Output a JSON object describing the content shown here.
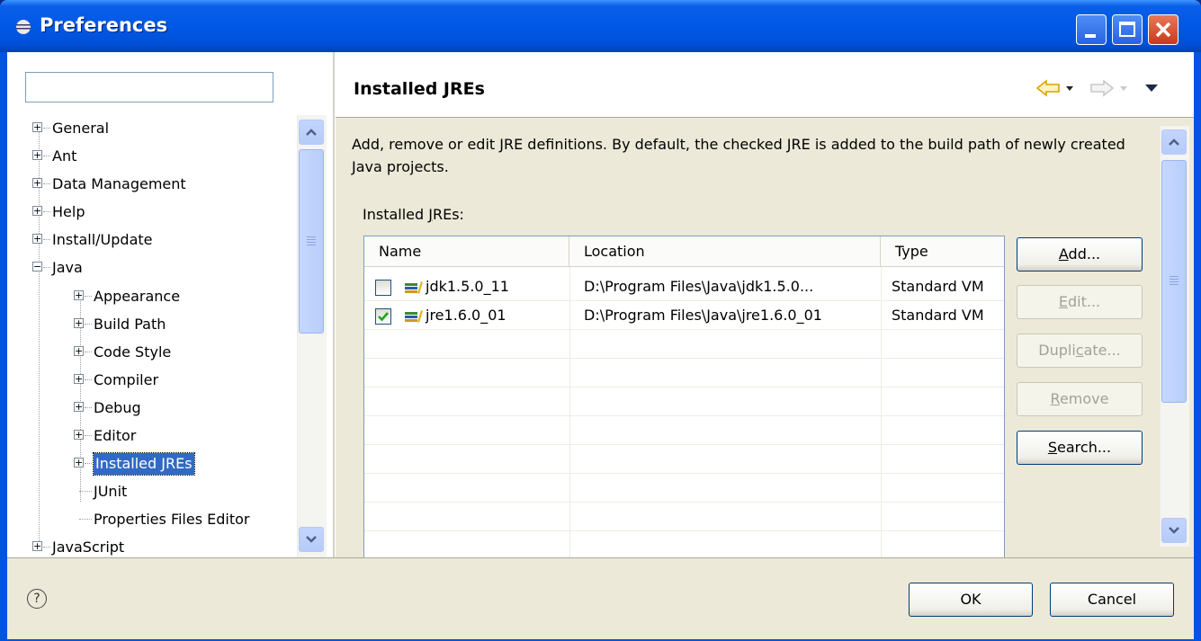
{
  "window": {
    "title": "Preferences"
  },
  "filter": {
    "value": ""
  },
  "tree": {
    "items": [
      {
        "label": "General",
        "expander": "+"
      },
      {
        "label": "Ant",
        "expander": "+"
      },
      {
        "label": "Data Management",
        "expander": "+"
      },
      {
        "label": "Help",
        "expander": "+"
      },
      {
        "label": "Install/Update",
        "expander": "+"
      },
      {
        "label": "Java",
        "expander": "−"
      },
      {
        "label": "Appearance",
        "expander": "+"
      },
      {
        "label": "Build Path",
        "expander": "+"
      },
      {
        "label": "Code Style",
        "expander": "+"
      },
      {
        "label": "Compiler",
        "expander": "+"
      },
      {
        "label": "Debug",
        "expander": "+"
      },
      {
        "label": "Editor",
        "expander": "+"
      },
      {
        "label": "Installed JREs",
        "expander": "+",
        "selected": true
      },
      {
        "label": "JUnit"
      },
      {
        "label": "Properties Files Editor"
      },
      {
        "label": "JavaScript",
        "expander": "+"
      }
    ]
  },
  "page": {
    "title": "Installed JREs",
    "description": "Add, remove or edit JRE definitions. By default, the checked JRE is added to the build path of newly created Java projects.",
    "jre_label_pre": "Installed ",
    "jre_label_mn": "J",
    "jre_label_post": "REs:"
  },
  "table": {
    "columns": [
      "Name",
      "Location",
      "Type"
    ],
    "rows": [
      {
        "checked": false,
        "name": "jdk1.5.0_11",
        "location": "D:\\Program Files\\Java\\jdk1.5.0...",
        "type": "Standard VM"
      },
      {
        "checked": true,
        "name": "jre1.6.0_01",
        "location": "D:\\Program Files\\Java\\jre1.6.0_01",
        "type": "Standard VM"
      }
    ]
  },
  "buttons": {
    "add": {
      "mn": "A",
      "rest": "dd...",
      "enabled": true
    },
    "edit": {
      "mn": "E",
      "rest": "dit...",
      "enabled": false
    },
    "duplicate": {
      "pre": "Dupli",
      "mn": "c",
      "rest": "ate...",
      "enabled": false
    },
    "remove": {
      "mn": "R",
      "rest": "emove",
      "enabled": false
    },
    "search": {
      "mn": "S",
      "rest": "earch...",
      "enabled": true
    }
  },
  "footer": {
    "help_icon": "?",
    "ok": "OK",
    "cancel": "Cancel"
  },
  "colors": {
    "titlebar": "#0054e3",
    "selection": "#316ac5",
    "check": "#21a121"
  }
}
